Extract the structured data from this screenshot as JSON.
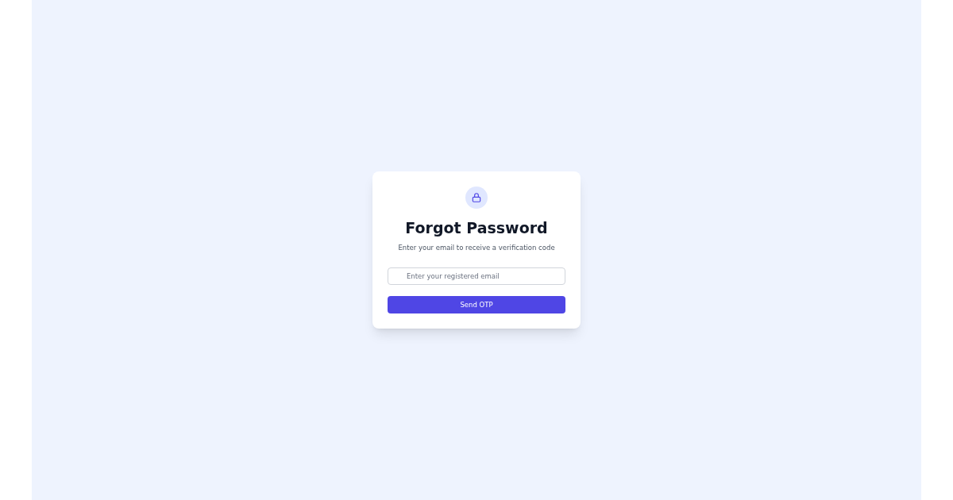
{
  "card": {
    "title": "Forgot Password",
    "subtitle": "Enter your email to receive a verification code"
  },
  "email_field": {
    "placeholder": "Enter your registered email"
  },
  "button": {
    "label": "Send OTP"
  }
}
